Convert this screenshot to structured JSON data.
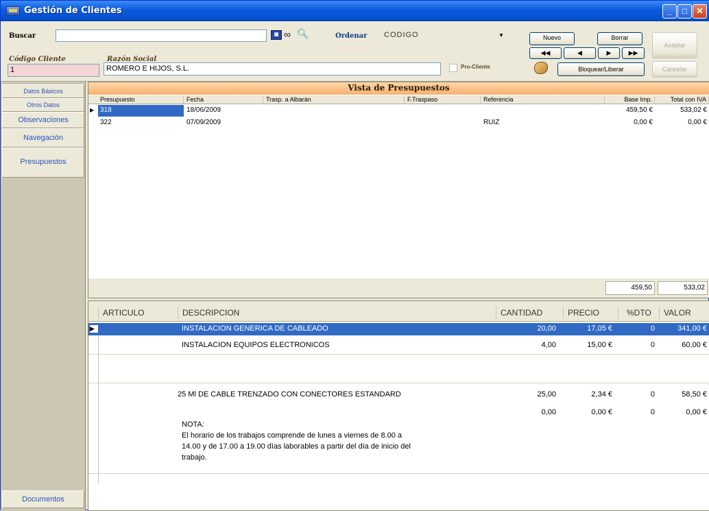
{
  "window": {
    "title": "Gestión de Clientes"
  },
  "search": {
    "label": "Buscar",
    "value": ""
  },
  "order": {
    "label": "Ordenar",
    "value": "CODIGO"
  },
  "client": {
    "code_label": "Código Cliente",
    "code_value": "1",
    "name_label": "Razón Social",
    "name_value": "ROMERO E HIJOS, S.L.",
    "pro_label": "Pro-Cliente"
  },
  "buttons": {
    "new": "Nuevo",
    "delete": "Borrar",
    "first": "◀◀",
    "prev": "◀",
    "next": "▶",
    "last": "▶▶",
    "accept": "Aceptar",
    "cancel": "Cancelar",
    "lock": "Bloquear/Liberar"
  },
  "sidebar": {
    "items": [
      "Datos Básicos",
      "Otros Datos",
      "Observaciones",
      "Navegación",
      "Presupuestos"
    ],
    "bottom": "Documentos"
  },
  "budgets": {
    "title": "Vista de Presupuestos",
    "columns": [
      "Presupuesto",
      "Fecha",
      "Trasp. a Albarán",
      "F.Traspaso",
      "Referencia",
      "Base Imp.",
      "Total con IVA"
    ],
    "rows": [
      {
        "presupuesto": "318",
        "fecha": "18/06/2009",
        "traspaso": "",
        "f_traspaso": "",
        "referencia": "",
        "base": "459,50 €",
        "total": "533,02 €"
      },
      {
        "presupuesto": "322",
        "fecha": "07/09/2009",
        "traspaso": "",
        "f_traspaso": "",
        "referencia": "RUIZ",
        "base": "0,00 €",
        "total": "0,00 €"
      }
    ],
    "sum_base": "459,50",
    "sum_total": "533,02"
  },
  "lines": {
    "columns": [
      "ARTICULO",
      "DESCRIPCION",
      "CANTIDAD",
      "PRECIO",
      "%DTO",
      "VALOR"
    ],
    "rows": [
      {
        "articulo": "",
        "descripcion": "INSTALACION GENERICA DE CABLEADO",
        "cantidad": "20,00",
        "precio": "17,05 €",
        "dto": "0",
        "valor": "341,00 €"
      },
      {
        "articulo": "",
        "descripcion": "INSTALACION EQUIPOS ELECTRONICOS",
        "cantidad": "4,00",
        "precio": "15,00 €",
        "dto": "0",
        "valor": "60,00 €"
      },
      {
        "articulo": "",
        "descripcion": "25 Ml DE CABLE TRENZADO CON CONECTORES ESTANDARD",
        "cantidad": "25,00",
        "precio": "2,34 €",
        "dto": "0",
        "valor": "58,50 €"
      },
      {
        "articulo": "",
        "descripcion": "",
        "cantidad": "0,00",
        "precio": "0,00 €",
        "dto": "0",
        "valor": "0,00 €"
      }
    ],
    "note": [
      "NOTA:",
      "El horario de los trabajos comprende de lunes a viernes de 8.00 a",
      "14.00 y de 17.00 a 19.00 días laborables a partir del día de inicio del",
      "trabajo."
    ]
  },
  "colors": {
    "title_bar": "#0a5adb",
    "selected_row": "#316ac5",
    "header_orange": "#f7b070",
    "sidebar_text": "#2a55c0"
  }
}
